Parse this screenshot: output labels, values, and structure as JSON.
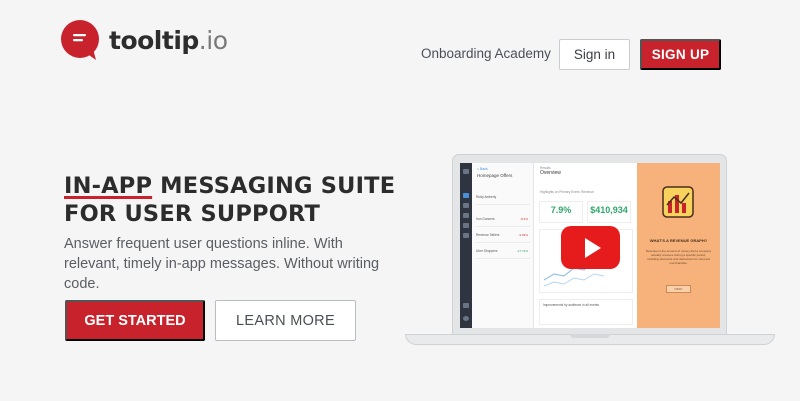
{
  "header": {
    "logo_text": "tooltip",
    "logo_suffix": ".io",
    "nav_link": "Onboarding Academy",
    "signin_label": "Sign in",
    "signup_label": "SIGN UP"
  },
  "hero": {
    "headline_accent": "IN-APP",
    "headline_line1_rest": " MESSAGING SUITE",
    "headline_line2": "FOR USER SUPPORT",
    "subhead": "Answer frequent user questions inline. With relevant, timely in-app messages. Without writing code.",
    "cta_primary": "GET STARTED",
    "cta_secondary": "LEARN MORE"
  },
  "colors": {
    "brand_red": "#c8232c",
    "play_red": "#e61c1c",
    "tooltip_orange": "#f6b27a"
  },
  "icons": {
    "logo": "speech-bubble-lines-icon",
    "play": "play-icon",
    "chart_card": "chart-card-icon"
  },
  "laptop_screen": {
    "list_head": "< Back",
    "list_title": "Homepage Offers",
    "list_rows": [
      {
        "label": "Ricky Amberly",
        "value": ""
      },
      {
        "label": "Iron Gunners",
        "value": "-8.6%",
        "tone": "red"
      },
      {
        "label": "Revenue Sellers",
        "value": "-9.99%",
        "tone": "red"
      },
      {
        "label": "Uber Shoppers",
        "value": "-27.76%",
        "tone": "green"
      }
    ],
    "main_small": "Results",
    "main_title": "Overview",
    "main_caption": "Highlights on Primary Event: Revenue",
    "stat_1": "7.9%",
    "stat_2": "$410,934",
    "panel2_text": "Improvements by audience in all events",
    "tooltip_title": "WHAT'S A REVENUE GRAPH?",
    "tooltip_text": "Revenue is the amount of money that a company actually receives during a specific period, including discounts and deductions for returned merchandise.",
    "tooltip_button": "OKAY"
  }
}
